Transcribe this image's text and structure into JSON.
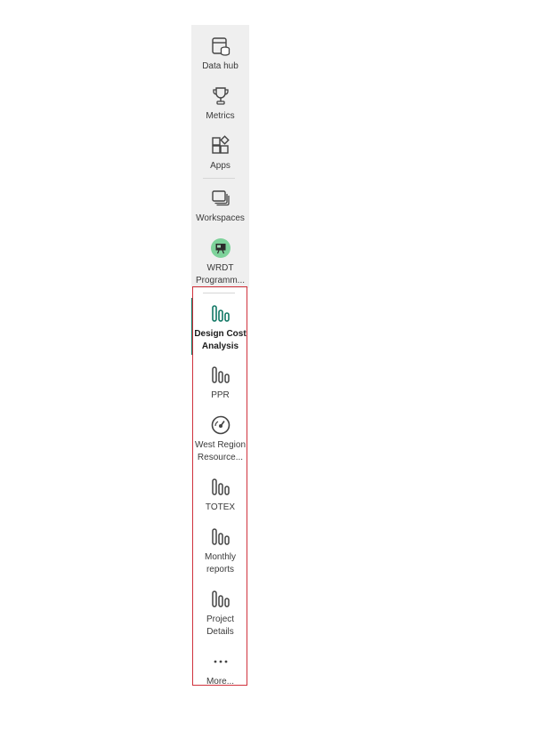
{
  "nav": {
    "data_hub": "Data hub",
    "metrics": "Metrics",
    "apps": "Apps",
    "workspaces": "Workspaces",
    "wrdt": "WRDT\nProgramm...",
    "design_cost": "Design Cost\nAnalysis",
    "ppr": "PPR",
    "west_region": "West Region\nResource...",
    "totex": "TOTEX",
    "monthly": "Monthly\nreports",
    "project_details": "Project\nDetails",
    "more": "More..."
  },
  "colors": {
    "accent": "#117865",
    "rail_bg": "#efefef",
    "highlight_border": "#d0323c",
    "workspace_badge": "#7dd29a"
  }
}
